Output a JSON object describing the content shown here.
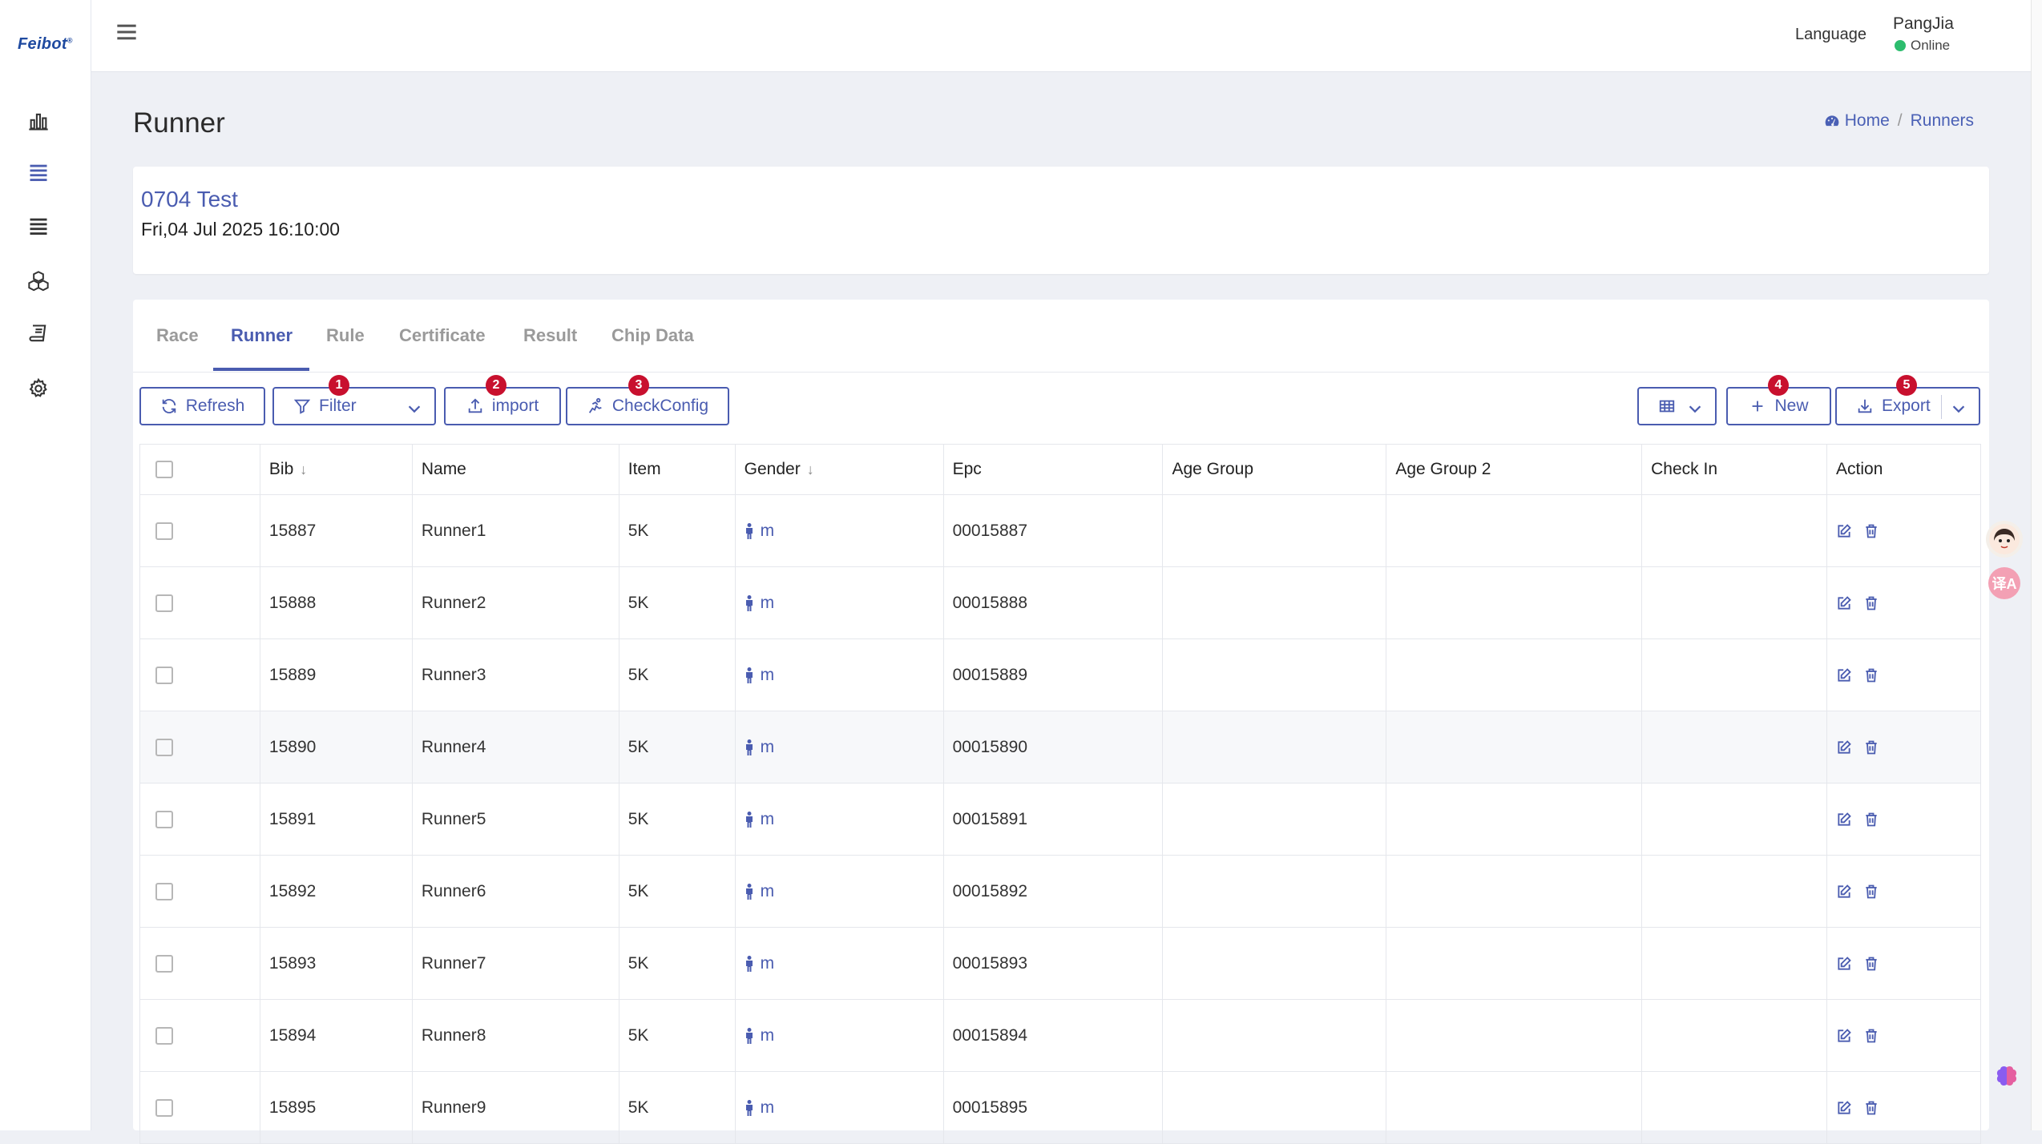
{
  "brand": {
    "name": "Feibot",
    "mark": "®"
  },
  "topbar": {
    "language": "Language",
    "user": {
      "name": "PangJia",
      "status": "Online"
    }
  },
  "sidebar": {
    "icons": [
      "chart-bar-icon",
      "list-icon",
      "list-alt-icon",
      "cubes-icon",
      "book-icon",
      "gear-icon"
    ]
  },
  "page": {
    "title": "Runner",
    "breadcrumb": {
      "home": "Home",
      "separator": "/",
      "current": "Runners"
    }
  },
  "race": {
    "name": "0704 Test",
    "datetime": "Fri,04 Jul 2025 16:10:00"
  },
  "tabs": [
    {
      "label": "Race"
    },
    {
      "label": "Runner"
    },
    {
      "label": "Rule"
    },
    {
      "label": "Certificate"
    },
    {
      "label": "Result"
    },
    {
      "label": "Chip Data"
    }
  ],
  "active_tab": "Runner",
  "toolbar": {
    "refresh": "Refresh",
    "filter": "Filter",
    "import": "import",
    "checkconfig": "CheckConfig",
    "new": "New",
    "export": "Export",
    "badges": [
      "1",
      "2",
      "3",
      "4",
      "5"
    ]
  },
  "table": {
    "columns": [
      "Bib",
      "Name",
      "Item",
      "Gender",
      "Epc",
      "Age Group",
      "Age Group 2",
      "Check In",
      "Action"
    ],
    "rows": [
      {
        "bib": "15887",
        "name": "Runner1",
        "item": "5K",
        "gender": "m",
        "epc": "00015887",
        "age_group": "",
        "age_group_2": "",
        "check_in": ""
      },
      {
        "bib": "15888",
        "name": "Runner2",
        "item": "5K",
        "gender": "m",
        "epc": "00015888",
        "age_group": "",
        "age_group_2": "",
        "check_in": ""
      },
      {
        "bib": "15889",
        "name": "Runner3",
        "item": "5K",
        "gender": "m",
        "epc": "00015889",
        "age_group": "",
        "age_group_2": "",
        "check_in": ""
      },
      {
        "bib": "15890",
        "name": "Runner4",
        "item": "5K",
        "gender": "m",
        "epc": "00015890",
        "age_group": "",
        "age_group_2": "",
        "check_in": ""
      },
      {
        "bib": "15891",
        "name": "Runner5",
        "item": "5K",
        "gender": "m",
        "epc": "00015891",
        "age_group": "",
        "age_group_2": "",
        "check_in": ""
      },
      {
        "bib": "15892",
        "name": "Runner6",
        "item": "5K",
        "gender": "m",
        "epc": "00015892",
        "age_group": "",
        "age_group_2": "",
        "check_in": ""
      },
      {
        "bib": "15893",
        "name": "Runner7",
        "item": "5K",
        "gender": "m",
        "epc": "00015893",
        "age_group": "",
        "age_group_2": "",
        "check_in": ""
      },
      {
        "bib": "15894",
        "name": "Runner8",
        "item": "5K",
        "gender": "m",
        "epc": "00015894",
        "age_group": "",
        "age_group_2": "",
        "check_in": ""
      },
      {
        "bib": "15895",
        "name": "Runner9",
        "item": "5K",
        "gender": "m",
        "epc": "00015895",
        "age_group": "",
        "age_group_2": "",
        "check_in": ""
      }
    ]
  },
  "floating": {
    "translate_glyph": "译A"
  },
  "colors": {
    "accent": "#4a5cb0",
    "badge": "#c8102e",
    "online": "#2dbd6e",
    "power": "#1c7fd6"
  }
}
